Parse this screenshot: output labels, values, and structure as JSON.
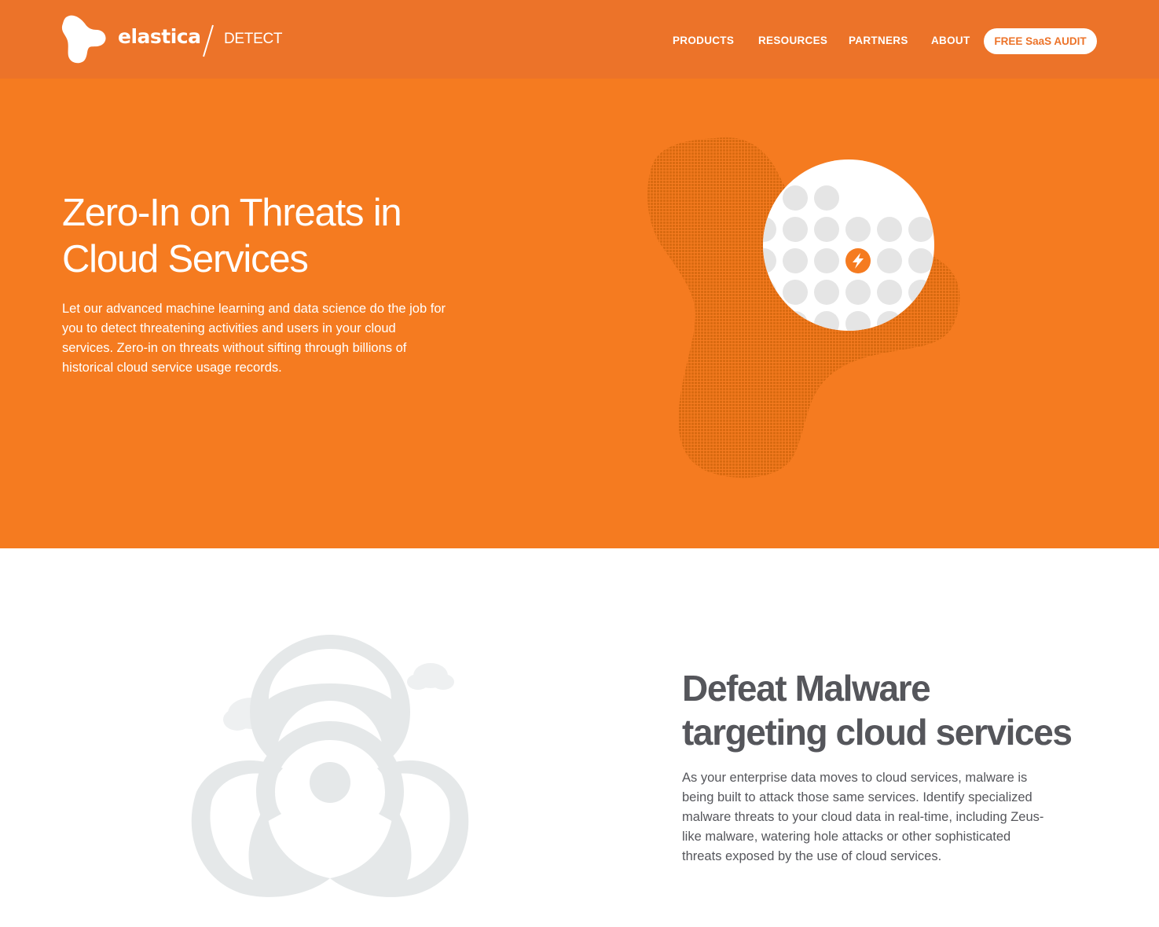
{
  "brand": {
    "name": "elastica",
    "product": "DETECT",
    "colors": {
      "header": "#ec7329",
      "hero": "#f57b20",
      "text_dark": "#55565b",
      "art_gray": "#e5e8e9"
    }
  },
  "nav": {
    "items": [
      "PRODUCTS",
      "RESOURCES",
      "PARTNERS",
      "ABOUT"
    ],
    "cta_label": "FREE SaaS AUDIT"
  },
  "hero": {
    "title_line1": "Zero-In on Threats in",
    "title_line2": "Cloud Services",
    "body": "Let our advanced machine learning and data science do the job for you to detect threatening activities and users in your cloud services. Zero-in on threats without sifting through billions of historical cloud service usage records.",
    "art_icon": "lightning-bolt-icon"
  },
  "malware": {
    "title_line1": "Defeat Malware",
    "title_line2": "targeting cloud services",
    "body": "As your enterprise data moves to cloud services, malware is being built to attack those same services. Identify specialized malware threats to your cloud data in real-time, including Zeus-like malware, watering hole attacks or other sophisticated threats exposed by the use of cloud services.",
    "art_icon": "biohazard-icon"
  }
}
